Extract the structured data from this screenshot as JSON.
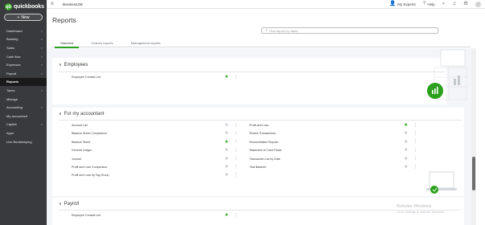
{
  "brand": {
    "logo_glyph": "qb",
    "logo_text": "quickbooks",
    "accent": "#2ca01c",
    "sidebar_bg": "#393a3d"
  },
  "new_button": {
    "plus": "+",
    "label": "New"
  },
  "sidebar": {
    "items": [
      {
        "label": "Dashboard",
        "chevron": ">",
        "active": false
      },
      {
        "label": "Banking",
        "chevron": ">",
        "active": false
      },
      {
        "label": "Sales",
        "chevron": ">",
        "active": false
      },
      {
        "label": "Cash flow",
        "chevron": ">",
        "active": false
      },
      {
        "label": "Expenses",
        "chevron": ">",
        "active": false
      },
      {
        "label": "Payroll",
        "chevron": ">",
        "active": false
      },
      {
        "label": "Reports",
        "chevron": "",
        "active": true
      },
      {
        "label": "Taxes",
        "chevron": ">",
        "active": false
      },
      {
        "label": "Mileage",
        "chevron": "",
        "active": false
      },
      {
        "label": "Accounting",
        "chevron": ">",
        "active": false
      },
      {
        "label": "My accountant",
        "chevron": "",
        "active": false
      },
      {
        "label": "Capital",
        "chevron": ">",
        "active": false
      },
      {
        "label": "Apps",
        "chevron": "",
        "active": false
      },
      {
        "label": "Live Bookkeeping",
        "chevron": "",
        "active": false
      }
    ]
  },
  "topbar": {
    "menu_icon": "hamburger-icon",
    "company": "BusinessJW",
    "my_experts": "My Experts",
    "help": "Help"
  },
  "page": {
    "title": "Reports",
    "search_placeholder": "Find report by name"
  },
  "tabs": [
    {
      "label": "Standard",
      "active": true
    },
    {
      "label": "Custom reports",
      "active": false
    },
    {
      "label": "Management reports",
      "active": false
    }
  ],
  "sections": {
    "employees": {
      "title": "Employees",
      "rows": [
        {
          "label": "Employee Contact List",
          "favorite": true
        }
      ]
    },
    "accountant": {
      "title": "For my accountant",
      "left_rows": [
        {
          "label": "Account List",
          "favorite": false
        },
        {
          "label": "Balance Sheet Comparison",
          "favorite": false
        },
        {
          "label": "Balance Sheet",
          "favorite": true
        },
        {
          "label": "General Ledger",
          "favorite": false
        },
        {
          "label": "Journal",
          "favorite": false
        },
        {
          "label": "Profit and Loss Comparison",
          "favorite": false
        },
        {
          "label": "Profit and Loss by Tag Group",
          "favorite": false
        }
      ],
      "right_rows": [
        {
          "label": "Profit and Loss",
          "favorite": true
        },
        {
          "label": "Recent Transactions",
          "favorite": false
        },
        {
          "label": "Reconciliation Reports",
          "favorite": false
        },
        {
          "label": "Statement of Cash Flows",
          "favorite": false
        },
        {
          "label": "Transaction List by Date",
          "favorite": false
        },
        {
          "label": "Trial Balance",
          "favorite": false
        }
      ]
    },
    "payroll": {
      "title": "Payroll",
      "rows": [
        {
          "label": "Employee Contact List",
          "favorite": true
        }
      ]
    }
  },
  "glyphs": {
    "star": "★",
    "kebab": "⋮",
    "caret": "∨",
    "chevron": ">"
  },
  "watermark": {
    "title": "Activate Windows",
    "subtitle": "Go to Settings to activate Windows."
  }
}
